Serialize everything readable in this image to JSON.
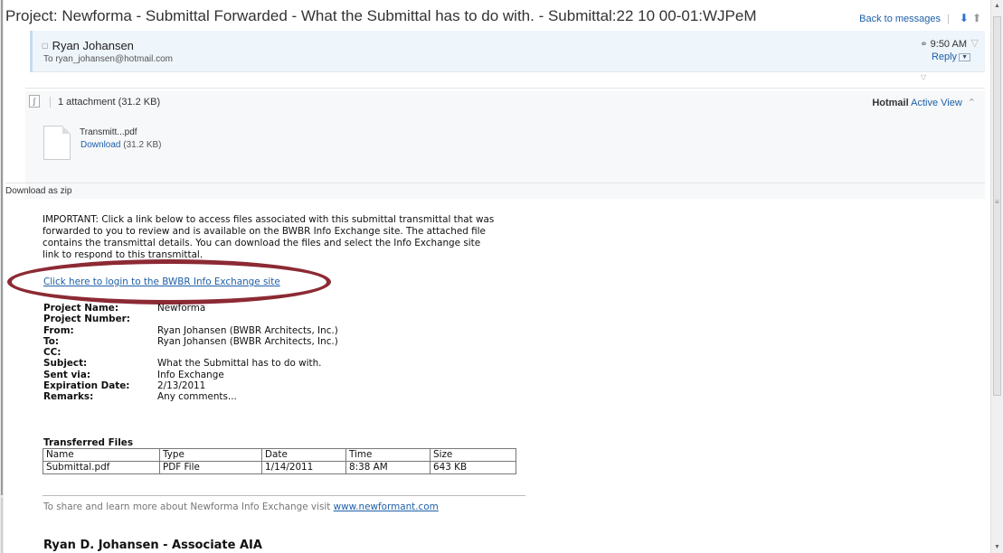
{
  "subject": "Project: Newforma - Submittal Forwarded - What the Submittal has to do with. - Submittal:22 10 00-01:WJPeM",
  "toolbar": {
    "back_label": "Back to messages",
    "next_icon": "down-arrow-icon",
    "prev_icon": "up-arrow-icon"
  },
  "sender": {
    "name": "Ryan Johansen",
    "to": "To ryan_johansen@hotmail.com",
    "time": "9:50 AM",
    "reply_label": "Reply"
  },
  "attachments": {
    "summary": "1 attachment (31.2 KB)",
    "hotmail": "Hotmail",
    "active_view": "Active View",
    "file_name": "Transmitt...pdf",
    "download_label": "Download",
    "download_size": "(31.2 KB)",
    "zip_label": "Download as zip"
  },
  "body": {
    "important": "IMPORTANT: Click a link below to access files associated with this submittal transmittal that was forwarded to you to review and is available on the BWBR Info Exchange site. The attached file contains the transmittal details. You can download the files and select the Info Exchange site link to respond to this transmittal.",
    "login_link": "Click here to login to the BWBR Info Exchange site"
  },
  "fields": [
    {
      "label": "Project Name:",
      "value": "Newforma"
    },
    {
      "label": "Project Number:",
      "value": ""
    },
    {
      "label": "From:",
      "value": "Ryan Johansen (BWBR Architects, Inc.)"
    },
    {
      "label": "To:",
      "value": "Ryan Johansen (BWBR Architects, Inc.)"
    },
    {
      "label": "CC:",
      "value": ""
    },
    {
      "label": "Subject:",
      "value": "What the Submittal has to do with."
    },
    {
      "label": "Sent via:",
      "value": "Info Exchange"
    },
    {
      "label": "Expiration Date:",
      "value": "2/13/2011"
    },
    {
      "label": "Remarks:",
      "value": "Any comments..."
    }
  ],
  "transferred": {
    "title": "Transferred Files",
    "headers": [
      "Name",
      "Type",
      "Date",
      "Time",
      "Size"
    ],
    "rows": [
      [
        "Submittal.pdf",
        "PDF File",
        "1/14/2011",
        "8:38 AM",
        "643 KB"
      ]
    ]
  },
  "footer": {
    "share_text": "To share and learn more about Newforma Info Exchange visit",
    "share_link": "www.newformant.com",
    "signature": "Ryan D. Johansen - Associate AIA"
  },
  "colors": {
    "link": "#1e5fa8",
    "highlight_ellipse": "#8c2a34",
    "header_bg": "#eef5fb"
  }
}
